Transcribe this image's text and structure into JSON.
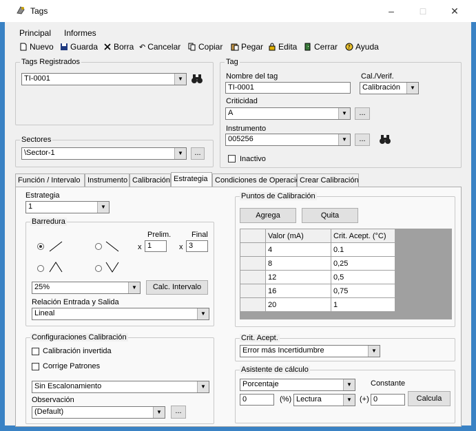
{
  "window": {
    "title": "Tags",
    "minimize": "–",
    "maximize": "□",
    "close": "✕"
  },
  "menu": {
    "items": [
      "Principal",
      "Informes"
    ]
  },
  "toolbar": {
    "nuevo": "Nuevo",
    "guarda": "Guarda",
    "borra": "Borra",
    "cancelar": "Cancelar",
    "copiar": "Copiar",
    "pegar": "Pegar",
    "edita": "Edita",
    "cerrar": "Cerrar",
    "ayuda": "Ayuda"
  },
  "tags_registrados": {
    "legend": "Tags Registrados",
    "value": "TI-0001"
  },
  "sectores": {
    "legend": "Sectores",
    "value": "\\Sector-1",
    "browse": "..."
  },
  "tag": {
    "legend": "Tag",
    "nombre_label": "Nombre del tag",
    "nombre_value": "TI-0001",
    "calverif_label": "Cal./Verif.",
    "calverif_value": "Calibración",
    "criticidad_label": "Criticidad",
    "criticidad_value": "A",
    "criticidad_browse": "...",
    "instrumento_label": "Instrumento",
    "instrumento_value": "005256",
    "instrumento_browse": "...",
    "inactivo_label": "Inactivo"
  },
  "tabs": [
    "Función / Intervalo",
    "Instrumento",
    "Calibración",
    "Estrategia",
    "Condiciones de Operación",
    "Crear Calibración"
  ],
  "estrategia": {
    "label": "Estrategia",
    "value": "1",
    "barredura": {
      "legend": "Barredura",
      "prelim_label": "Prelim.",
      "final_label": "Final",
      "x1": "x",
      "prelim_value": "1",
      "x2": "x",
      "final_value": "3"
    },
    "percent_value": "25%",
    "calc_button": "Calc. Intervalo",
    "relacion_label": "Relación Entrada y Salida",
    "relacion_value": "Lineal"
  },
  "configuraciones": {
    "legend": "Configuraciones Calibración",
    "cal_invertida": "Calibración invertida",
    "corrige": "Corrige Patrones",
    "escalonamiento": "Sin Escalonamiento",
    "observacion_label": "Observación",
    "observacion_value": "(Default)",
    "observacion_browse": "..."
  },
  "puntos": {
    "legend": "Puntos de Calibración",
    "agrega": "Agrega",
    "quita": "Quita",
    "columns": [
      "Valor (mA)",
      "Crit. Acept. (°C)"
    ],
    "rows": [
      [
        "4",
        "0.1"
      ],
      [
        "8",
        "0,25"
      ],
      [
        "12",
        "0,5"
      ],
      [
        "16",
        "0,75"
      ],
      [
        "20",
        "1"
      ]
    ]
  },
  "crit": {
    "legend": "Crit. Acept.",
    "value": "Error más Incertidumbre"
  },
  "asistente": {
    "legend": "Asistente de cálculo",
    "mode": "Porcentaje",
    "constante_label": "Constante",
    "value1": "0",
    "pct": "(%)",
    "lectura": "Lectura",
    "plus": "(+)",
    "value2": "0",
    "calcula": "Calcula"
  }
}
